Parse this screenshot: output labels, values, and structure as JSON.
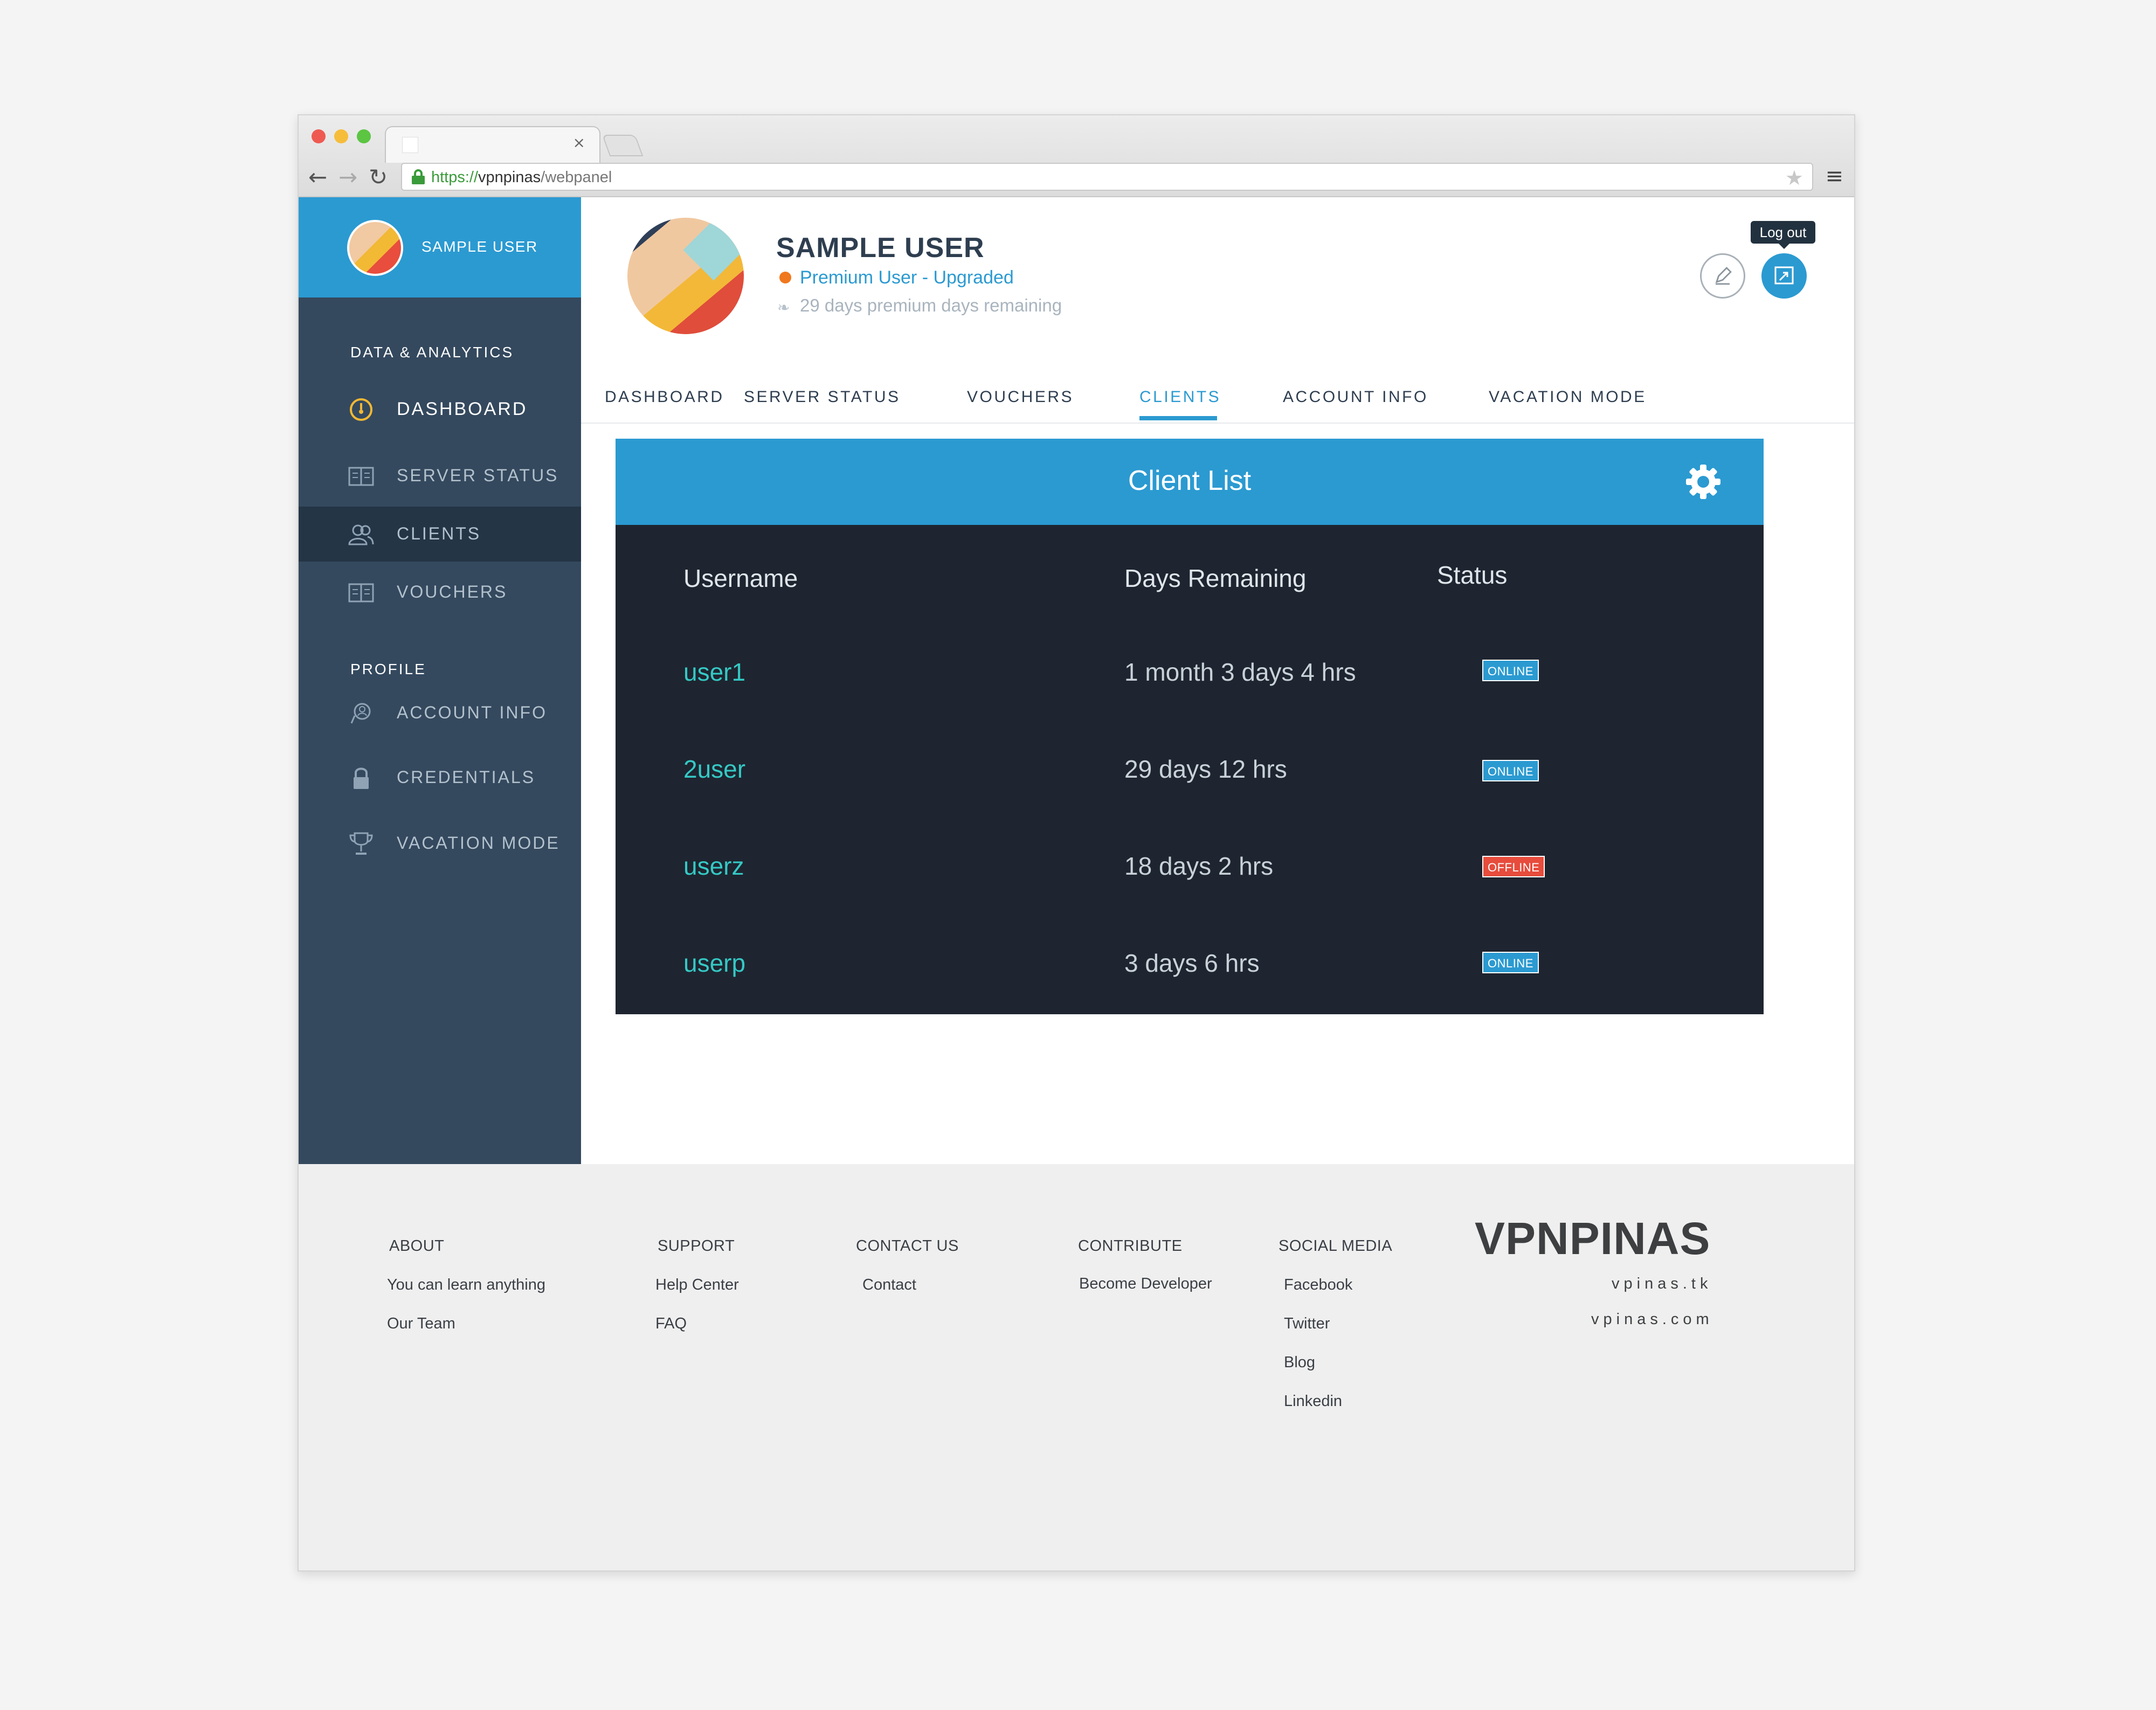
{
  "browser": {
    "url_scheme": "https://",
    "url_host": "vpnpinas",
    "url_path": "/webpanel",
    "tab_close": "×"
  },
  "sidebar": {
    "user_name": "SAMPLE USER",
    "section_data": "DATA & ANALYTICS",
    "section_profile": "PROFILE",
    "items": [
      {
        "label": "DASHBOARD",
        "icon": "gauge-icon"
      },
      {
        "label": "SERVER STATUS",
        "icon": "book-icon"
      },
      {
        "label": "CLIENTS",
        "icon": "users-icon"
      },
      {
        "label": "VOUCHERS",
        "icon": "book-icon"
      },
      {
        "label": "ACCOUNT INFO",
        "icon": "person-icon"
      },
      {
        "label": "CREDENTIALS",
        "icon": "lock-icon"
      },
      {
        "label": "VACATION MODE",
        "icon": "trophy-icon"
      }
    ]
  },
  "profile": {
    "name": "SAMPLE USER",
    "role": "Premium User - Upgraded",
    "days_remaining": "29 days premium days remaining",
    "logout_tooltip": "Log out"
  },
  "tabs": [
    "DASHBOARD",
    "SERVER STATUS",
    "VOUCHERS",
    "CLIENTS",
    "ACCOUNT INFO",
    "VACATION MODE"
  ],
  "active_tab": "CLIENTS",
  "client_list": {
    "title": "Client List",
    "columns": [
      "Username",
      "Days Remaining",
      "Status"
    ],
    "rows": [
      {
        "username": "user1",
        "days": "1 month 3 days 4 hrs",
        "status": "ONLINE"
      },
      {
        "username": "2user",
        "days": "29 days 12 hrs",
        "status": "ONLINE"
      },
      {
        "username": "userz",
        "days": "18 days 2 hrs",
        "status": "OFFLINE"
      },
      {
        "username": "userp",
        "days": "3 days 6 hrs",
        "status": "ONLINE"
      }
    ]
  },
  "footer": {
    "about": {
      "heading": "ABOUT",
      "links": [
        "You can learn anything",
        "Our Team"
      ]
    },
    "support": {
      "heading": "SUPPORT",
      "links": [
        "Help Center",
        "FAQ"
      ]
    },
    "contact": {
      "heading": "CONTACT US",
      "links": [
        "Contact"
      ]
    },
    "contribute": {
      "heading": "CONTRIBUTE",
      "links": [
        "Become Developer"
      ]
    },
    "social": {
      "heading": "SOCIAL MEDIA",
      "links": [
        "Facebook",
        "Twitter",
        "Blog",
        "Linkedin"
      ]
    },
    "brand": "VPNPINAS",
    "sites": [
      "vpinas.tk",
      "vpinas.com"
    ]
  },
  "colors": {
    "accent": "#2b9ad1",
    "sidebar": "#34495e",
    "card": "#1e2530",
    "username": "#35c9c5",
    "offline": "#e74c3c",
    "role_dot": "#f0781e"
  }
}
